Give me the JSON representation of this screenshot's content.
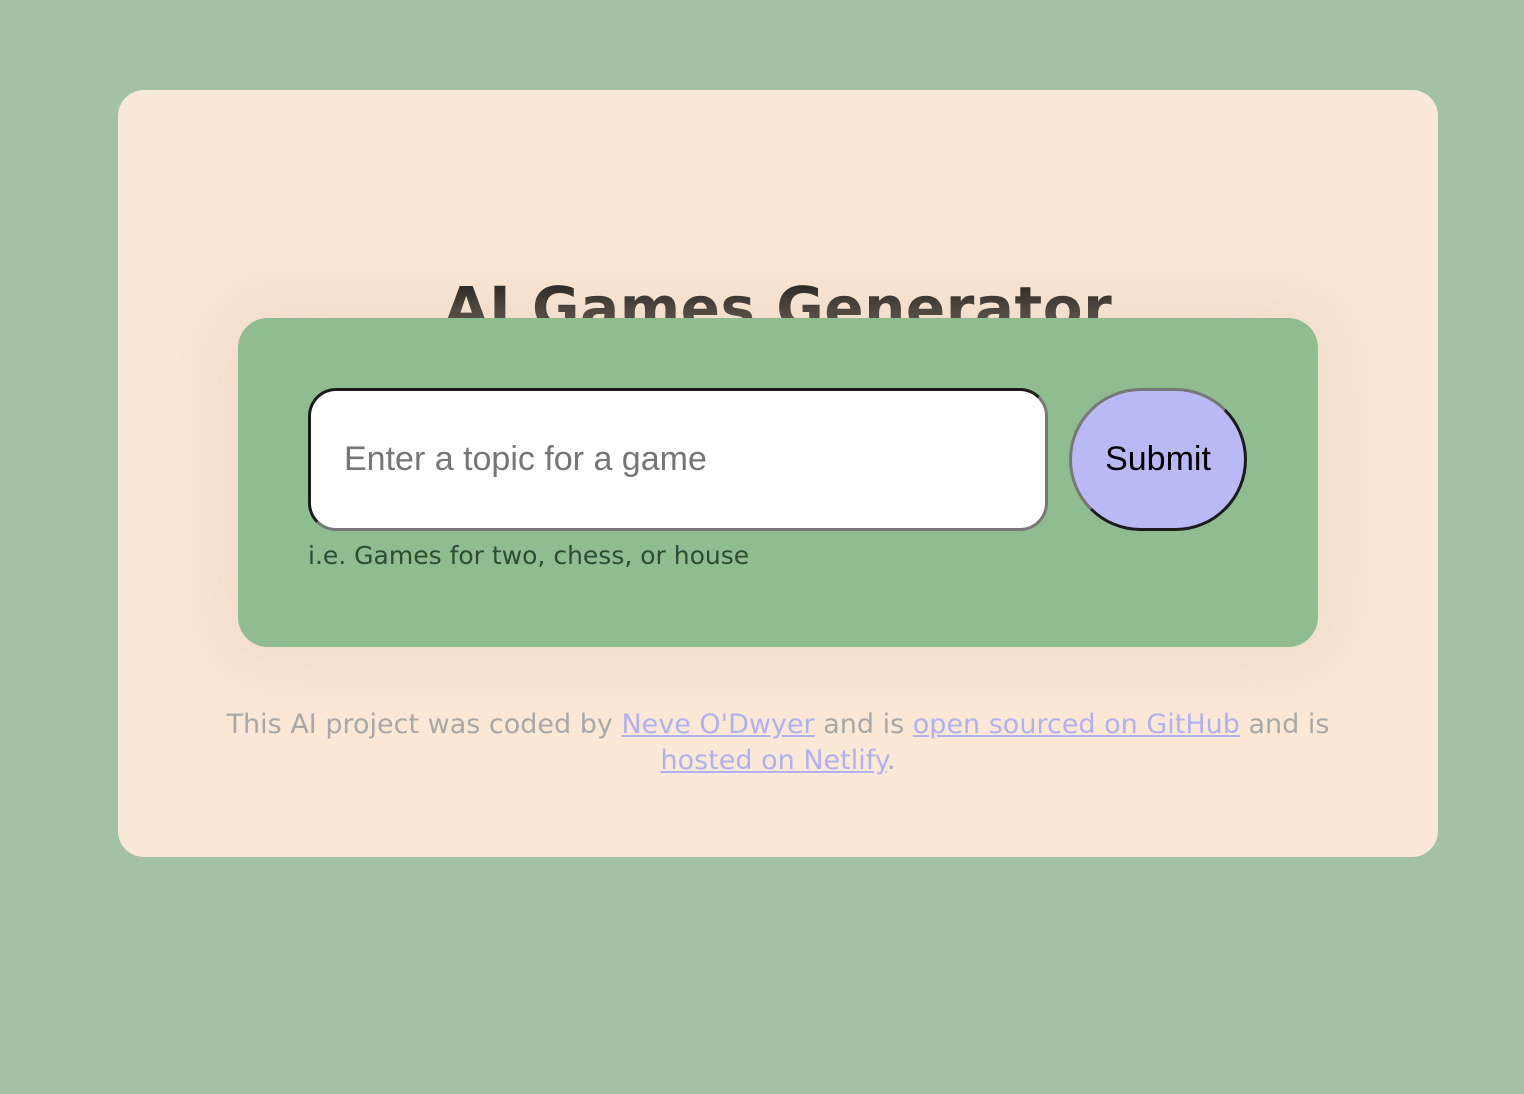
{
  "app": {
    "title": "AI Games Generator"
  },
  "form": {
    "input_placeholder": "Enter a topic for a game",
    "input_value": "",
    "submit_label": "Submit",
    "hint": "i.e. Games for two, chess, or house"
  },
  "footer": {
    "text_1": "This AI project was coded by ",
    "link_author": "Neve O'Dwyer",
    "text_2": " and is ",
    "link_github": "open sourced on GitHub",
    "text_3": " and is ",
    "link_netlify": "hosted on Netlify",
    "text_4": "."
  },
  "colors": {
    "background": "#a3c1a3",
    "card": "#fbe9d7",
    "form_panel": "#8fbd8f",
    "submit_button": "#b9b9f5",
    "link": "#b3b0f0",
    "footer_text": "#a8a8a8"
  }
}
